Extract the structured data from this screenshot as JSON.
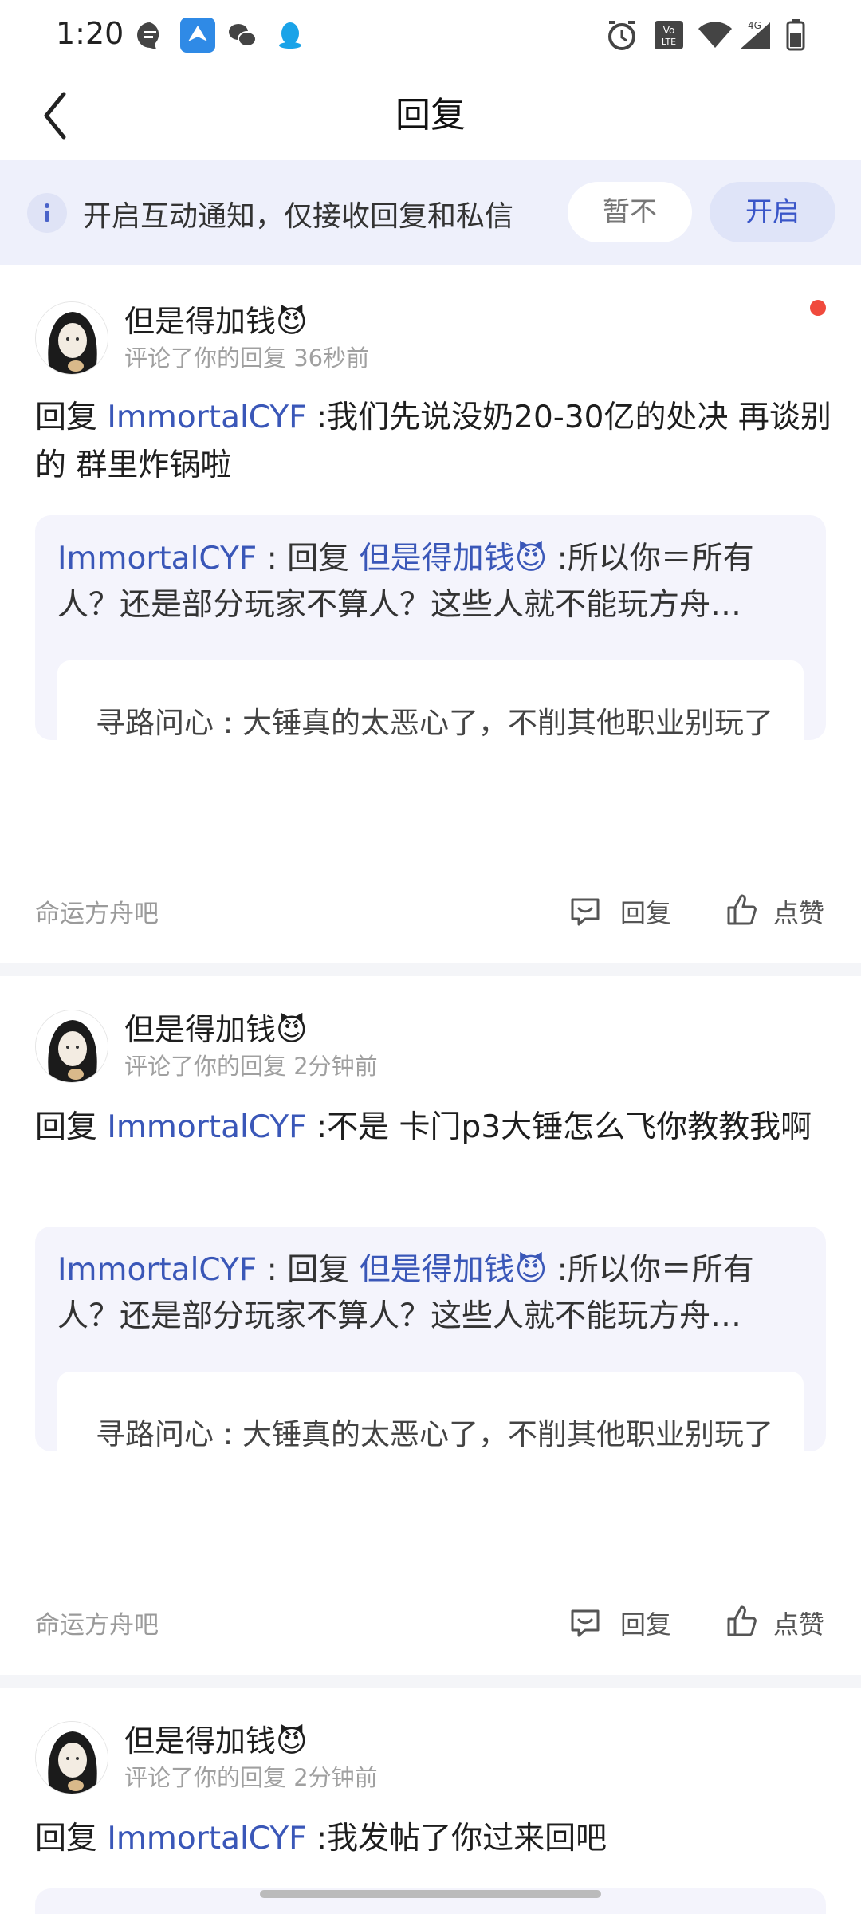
{
  "status_bar": {
    "time": "1:20",
    "left_icons": [
      "message-icon",
      "app-icon",
      "wechat-icon",
      "qq-icon"
    ],
    "right_icons": [
      "alarm-icon",
      "volte-icon",
      "wifi-icon",
      "signal-4g-icon",
      "battery-icon"
    ],
    "network_label": "4G"
  },
  "header": {
    "title": "回复"
  },
  "notice": {
    "text": "开启互动通知，仅接收回复和私信",
    "later_label": "暂不",
    "open_label": "开启"
  },
  "cards": [
    {
      "username": "但是得加钱😈",
      "subline": "评论了你的回复  36秒前",
      "unread": true,
      "reply_prefix": "回复 ",
      "reply_link": "ImmortalCYF",
      "reply_body": " :我们先说没奶20-30亿的处决 再谈别的 群里炸锅啦",
      "quote_author": "ImmortalCYF",
      "quote_mid": " : 回复 ",
      "quote_link": "但是得加钱😈",
      "quote_body": " :所以你＝所有人？还是部分玩家不算人？这些人就不能玩方舟…",
      "inner": "寻路问心 : 大锤真的太恶心了，不削其他职业别玩了",
      "forum": "命运方舟吧",
      "reply_label": "回复",
      "like_label": "点赞"
    },
    {
      "username": "但是得加钱😈",
      "subline": "评论了你的回复  2分钟前",
      "unread": false,
      "reply_prefix": "回复 ",
      "reply_link": "ImmortalCYF",
      "reply_body": " :不是 卡门p3大锤怎么飞你教教我啊",
      "quote_author": "ImmortalCYF",
      "quote_mid": " : 回复 ",
      "quote_link": "但是得加钱😈",
      "quote_body": " :所以你＝所有人？还是部分玩家不算人？这些人就不能玩方舟…",
      "inner": "寻路问心 : 大锤真的太恶心了，不削其他职业别玩了",
      "forum": "命运方舟吧",
      "reply_label": "回复",
      "like_label": "点赞"
    },
    {
      "username": "但是得加钱😈",
      "subline": "评论了你的回复  2分钟前",
      "unread": false,
      "reply_prefix": "回复 ",
      "reply_link": "ImmortalCYF",
      "reply_body": " :我发帖了你过来回吧"
    }
  ],
  "colors": {
    "accent": "#3a57b8",
    "banner_bg": "#eef0fb",
    "quote_bg": "#f4f4fc",
    "unread_dot": "#f04a3d"
  }
}
